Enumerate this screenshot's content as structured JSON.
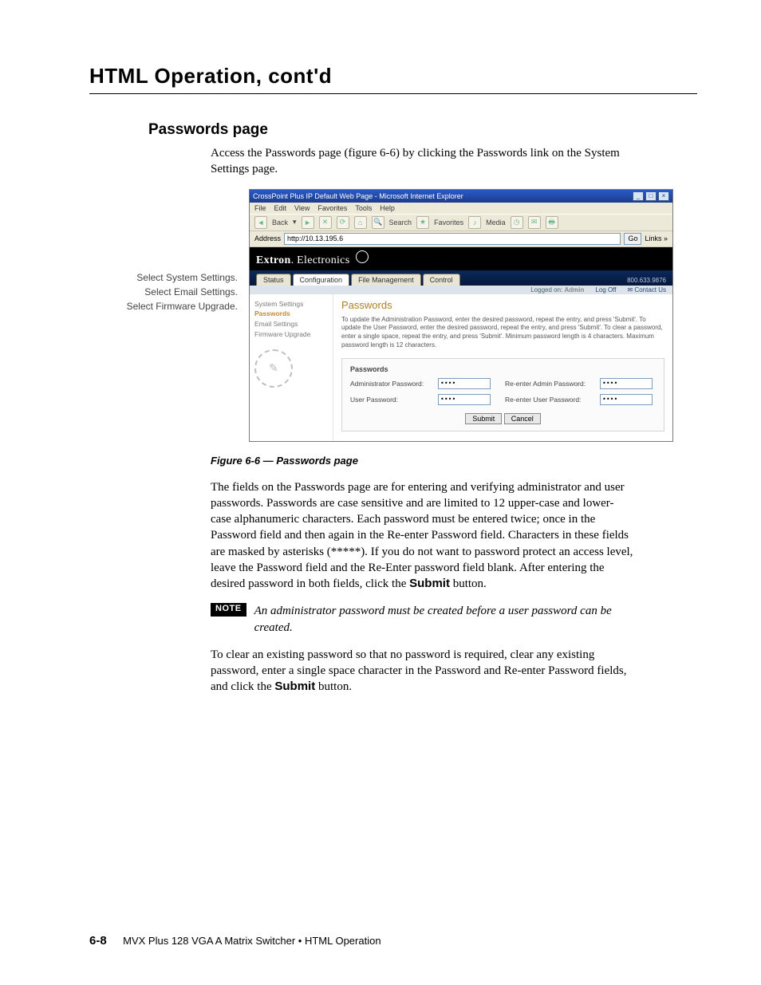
{
  "chapter_title": "HTML Operation, cont'd",
  "section_title": "Passwords page",
  "intro_text": "Access the Passwords page (figure 6-6) by clicking the Passwords link on the System Settings page.",
  "callouts": {
    "a": "Select System Settings.",
    "b": "Select Email Settings.",
    "c": "Select Firmware Upgrade."
  },
  "browser": {
    "title": "CrossPoint Plus IP Default Web Page - Microsoft Internet Explorer",
    "menu": [
      "File",
      "Edit",
      "View",
      "Favorites",
      "Tools",
      "Help"
    ],
    "toolbar": {
      "back": "Back",
      "search": "Search",
      "favorites": "Favorites",
      "media": "Media"
    },
    "address_label": "Address",
    "address_value": "http://10.13.195.6",
    "go": "Go",
    "links": "Links »",
    "brand_a": "Extron",
    "brand_b": "Electronics",
    "phone": "800.633.9876",
    "tabs": [
      "Status",
      "Configuration",
      "File Management",
      "Control"
    ],
    "logged_label": "Logged on:",
    "logged_user": "Admin",
    "logoff": "Log Off",
    "contact": "Contact Us",
    "sidebar": {
      "items": [
        "System Settings",
        "Passwords",
        "Email Settings",
        "Firmware Upgrade"
      ]
    },
    "page": {
      "heading": "Passwords",
      "explain": "To update the Administration Password, enter the desired password, repeat the entry, and press 'Submit'. To update the User Password, enter the desired password, repeat the entry, and press 'Submit'. To clear a password, enter a single space, repeat the entry, and press 'Submit'. Minimum password length is 4 characters. Maximum password length is 12 characters.",
      "panel_title": "Passwords",
      "admin_label": "Administrator Password:",
      "admin_value": "••••",
      "admin_re_label": "Re-enter Admin Password:",
      "admin_re_value": "••••",
      "user_label": "User Password:",
      "user_value": "••••",
      "user_re_label": "Re-enter User Password:",
      "user_re_value": "••••",
      "submit": "Submit",
      "cancel": "Cancel"
    }
  },
  "figure_caption": "Figure 6-6 — Passwords page",
  "para1": "The fields on the Passwords page are for entering and verifying administrator and user passwords.  Passwords are case sensitive and are limited to 12 upper-case and lower-case alphanumeric characters.  Each password must be entered twice; once in the Password field and then again in the Re-enter Password field.  Characters in these fields are masked by asterisks (*****).  If you do not want to password protect an access level, leave the Password field and the Re-Enter password field blank.  After entering the desired password in both fields, click the ",
  "para1_bold": "Submit",
  "para1_after": " button.",
  "note_label": "NOTE",
  "note_text": "An administrator password must be created before a user password can be created.",
  "para2a": "To clear an existing password so that no password is required, clear any existing password, enter a single space character in the Password and Re-enter Password fields, and click the ",
  "para2_bold": "Submit",
  "para2b": " button.",
  "footer": {
    "page": "6-8",
    "text": "MVX Plus 128 VGA A Matrix Switcher • HTML Operation"
  }
}
